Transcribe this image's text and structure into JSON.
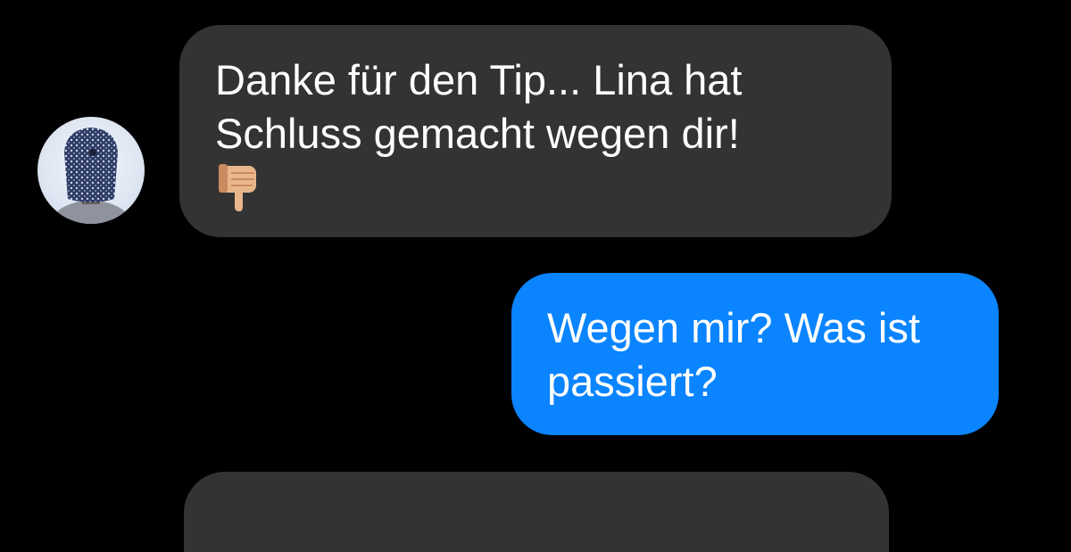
{
  "contact": {
    "avatar": "contact-avatar"
  },
  "messages": [
    {
      "direction": "received",
      "lines": [
        "Danke für den Tip... Lina hat",
        "Schluss gemacht wegen dir!"
      ],
      "emoji": "thumbs-down-icon"
    },
    {
      "direction": "sent",
      "lines": [
        "Wegen mir? Was ist",
        "passiert?"
      ]
    }
  ],
  "colors": {
    "background": "#000000",
    "received_bubble": "#333333",
    "sent_bubble": "#0a84ff",
    "text": "#ffffff"
  }
}
